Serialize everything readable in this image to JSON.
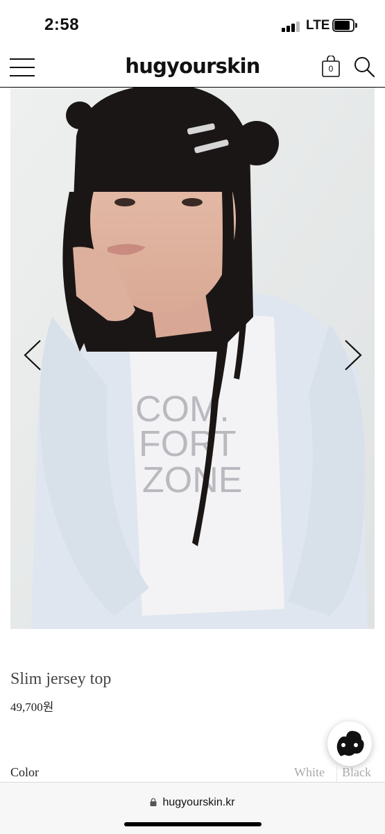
{
  "status": {
    "time": "2:58",
    "network": "LTE"
  },
  "header": {
    "logo": "hugyourskin",
    "cart_count": "0"
  },
  "product": {
    "name": "Slim jersey top",
    "price": "49,700원",
    "shirt_print": [
      "COM.",
      "FORT",
      "ZONE"
    ]
  },
  "options": {
    "color_label": "Color",
    "colors": [
      "White",
      "Black"
    ]
  },
  "browser": {
    "url": "hugyourskin.kr"
  },
  "icons": {
    "menu": "hamburger-icon",
    "cart": "shopping-bag-icon",
    "search": "search-icon",
    "prev": "chevron-left-icon",
    "next": "chevron-right-icon",
    "chat": "chat-icon",
    "lock": "lock-icon"
  }
}
